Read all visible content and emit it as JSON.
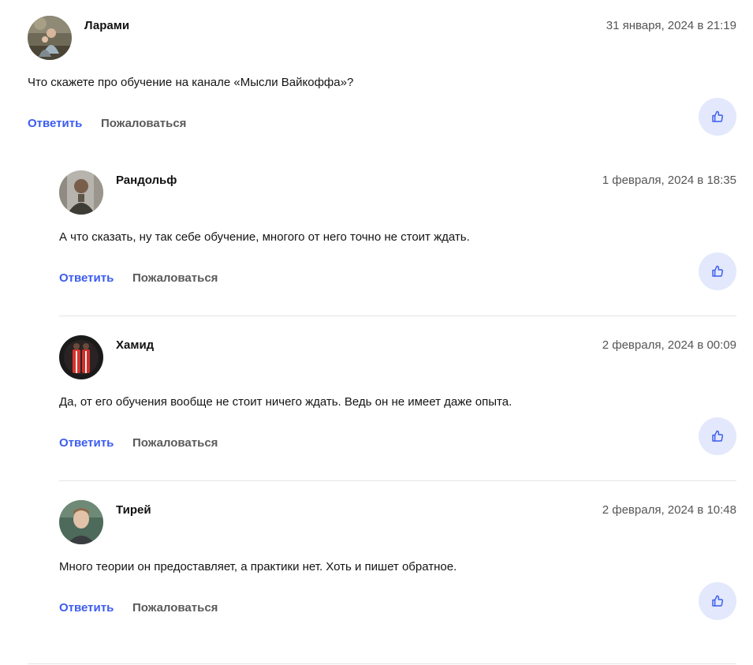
{
  "comments": [
    {
      "author": "Ларами",
      "date": "31 января, 2024 в 21:19",
      "text": "Что скажете про обучение на канале «Мысли Вайкоффа»?",
      "reply_label": "Ответить",
      "report_label": "Пожаловаться"
    },
    {
      "author": "Рандольф",
      "date": "1 февраля, 2024 в 18:35",
      "text": "А что сказать, ну так себе обучение, многого от него точно не стоит ждать.",
      "reply_label": "Ответить",
      "report_label": "Пожаловаться"
    },
    {
      "author": "Хамид",
      "date": "2 февраля, 2024 в 00:09",
      "text": "Да, от его обучения вообще не стоит ничего ждать. Ведь он не имеет даже опыта.",
      "reply_label": "Ответить",
      "report_label": "Пожаловаться"
    },
    {
      "author": "Тирей",
      "date": "2 февраля, 2024 в 10:48",
      "text": "Много теории он предоставляет, а практики нет. Хоть и пишет обратное.",
      "reply_label": "Ответить",
      "report_label": "Пожаловаться"
    }
  ],
  "colors": {
    "accent": "#3b5cf0",
    "like_background": "#e3e8fc",
    "muted_text": "#5a5a5a",
    "divider": "#e4e4e4"
  },
  "icons": {
    "like": "thumbs-up-icon"
  }
}
